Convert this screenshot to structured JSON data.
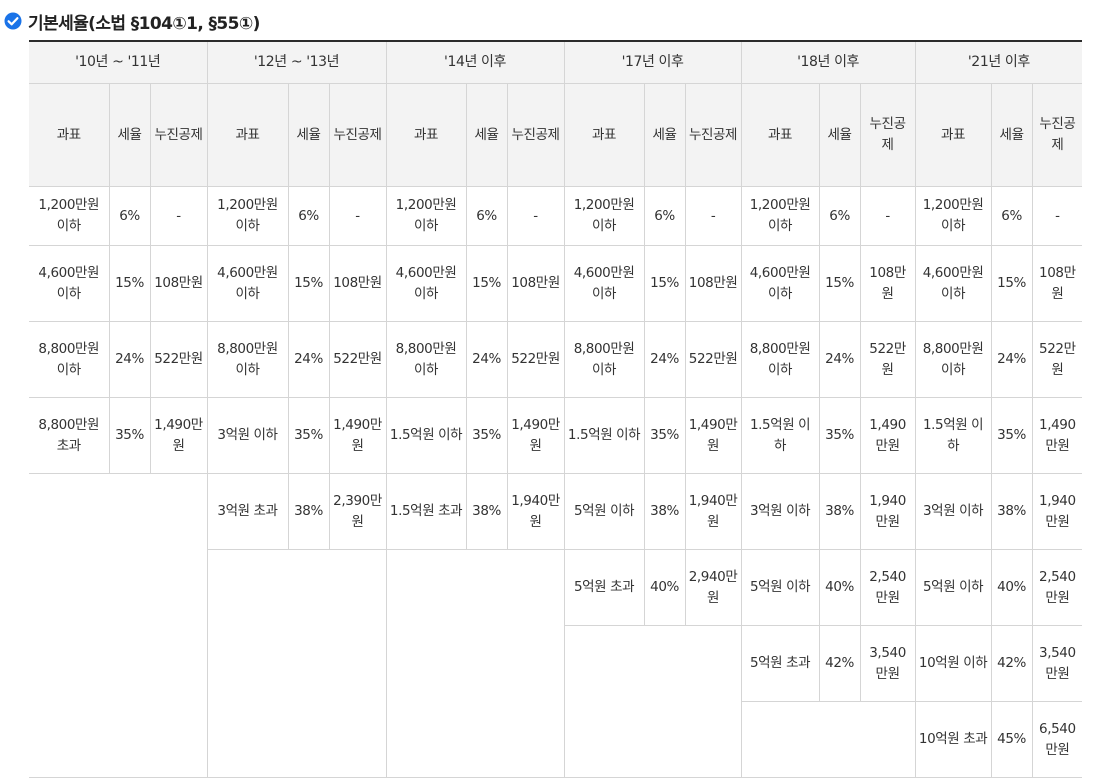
{
  "header": {
    "title": "기본세율(소법 §104①1, §55①)",
    "icon": "check-circle-icon",
    "accent_color": "#1a73e8"
  },
  "table": {
    "periods": [
      "'10년 ~ '11년",
      "'12년 ~ '13년",
      "'14년 이후",
      "'17년 이후",
      "'18년 이후",
      "'21년 이후"
    ],
    "subheaders": {
      "base": "과표",
      "rate": "세율",
      "deduction": "누진공제"
    },
    "rows": [
      [
        {
          "base": "1,200만원 이하",
          "rate": "6%",
          "deduction": "-"
        },
        {
          "base": "1,200만원 이하",
          "rate": "6%",
          "deduction": "-"
        },
        {
          "base": "1,200만원 이하",
          "rate": "6%",
          "deduction": "-"
        },
        {
          "base": "1,200만원 이하",
          "rate": "6%",
          "deduction": "-"
        },
        {
          "base": "1,200만원 이하",
          "rate": "6%",
          "deduction": "-"
        },
        {
          "base": "1,200만원 이하",
          "rate": "6%",
          "deduction": "-"
        }
      ],
      [
        {
          "base": "4,600만원 이하",
          "rate": "15%",
          "deduction": "108만원"
        },
        {
          "base": "4,600만원 이하",
          "rate": "15%",
          "deduction": "108만원"
        },
        {
          "base": "4,600만원 이하",
          "rate": "15%",
          "deduction": "108만원"
        },
        {
          "base": "4,600만원 이하",
          "rate": "15%",
          "deduction": "108만원"
        },
        {
          "base": "4,600만원 이하",
          "rate": "15%",
          "deduction": "108만원"
        },
        {
          "base": "4,600만원 이하",
          "rate": "15%",
          "deduction": "108만원"
        }
      ],
      [
        {
          "base": "8,800만원 이하",
          "rate": "24%",
          "deduction": "522만원"
        },
        {
          "base": "8,800만원 이하",
          "rate": "24%",
          "deduction": "522만원"
        },
        {
          "base": "8,800만원 이하",
          "rate": "24%",
          "deduction": "522만원"
        },
        {
          "base": "8,800만원 이하",
          "rate": "24%",
          "deduction": "522만원"
        },
        {
          "base": "8,800만원 이하",
          "rate": "24%",
          "deduction": "522만원"
        },
        {
          "base": "8,800만원 이하",
          "rate": "24%",
          "deduction": "522만원"
        }
      ],
      [
        {
          "base": "8,800만원 초과",
          "rate": "35%",
          "deduction": "1,490만원"
        },
        {
          "base": "3억원 이하",
          "rate": "35%",
          "deduction": "1,490만원"
        },
        {
          "base": "1.5억원 이하",
          "rate": "35%",
          "deduction": "1,490만원"
        },
        {
          "base": "1.5억원 이하",
          "rate": "35%",
          "deduction": "1,490만원"
        },
        {
          "base": "1.5억원 이하",
          "rate": "35%",
          "deduction": "1,490만원"
        },
        {
          "base": "1.5억원 이하",
          "rate": "35%",
          "deduction": "1,490만원"
        }
      ],
      [
        null,
        {
          "base": "3억원 초과",
          "rate": "38%",
          "deduction": "2,390만원"
        },
        {
          "base": "1.5억원 초과",
          "rate": "38%",
          "deduction": "1,940만원"
        },
        {
          "base": "5억원 이하",
          "rate": "38%",
          "deduction": "1,940만원"
        },
        {
          "base": "3억원 이하",
          "rate": "38%",
          "deduction": "1,940만원"
        },
        {
          "base": "3억원 이하",
          "rate": "38%",
          "deduction": "1,940만원"
        }
      ],
      [
        null,
        null,
        null,
        {
          "base": "5억원 초과",
          "rate": "40%",
          "deduction": "2,940만원"
        },
        {
          "base": "5억원 이하",
          "rate": "40%",
          "deduction": "2,540만원"
        },
        {
          "base": "5억원 이하",
          "rate": "40%",
          "deduction": "2,540만원"
        }
      ],
      [
        null,
        null,
        null,
        null,
        {
          "base": "5억원 초과",
          "rate": "42%",
          "deduction": "3,540만원"
        },
        {
          "base": "10억원 이하",
          "rate": "42%",
          "deduction": "3,540만원"
        }
      ],
      [
        null,
        null,
        null,
        null,
        null,
        {
          "base": "10억원 초과",
          "rate": "45%",
          "deduction": "6,540만원"
        }
      ]
    ]
  }
}
